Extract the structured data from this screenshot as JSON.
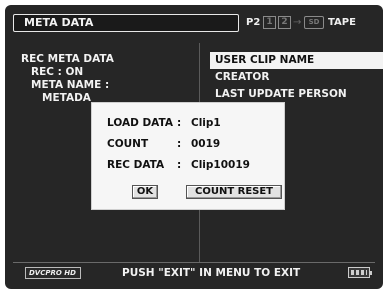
{
  "header": {
    "title": "META DATA",
    "mode": "P2",
    "slot_1": "1",
    "slot_2": "2",
    "arrow": "→",
    "sd_label": "SD",
    "tape": "TAPE"
  },
  "left_panel": {
    "lines": [
      "REC META DATA",
      "REC : ON",
      "META NAME :",
      "METADA"
    ]
  },
  "right_panel": {
    "items": [
      "USER CLIP NAME",
      "CREATOR",
      "LAST UPDATE PERSON"
    ]
  },
  "dialog": {
    "rows": [
      {
        "label": "LOAD DATA",
        "sep": ":",
        "value": "Clip1"
      },
      {
        "label": "COUNT",
        "sep": ":",
        "value": "0019"
      },
      {
        "label": "REC DATA",
        "sep": ":",
        "value": "Clip10019"
      }
    ],
    "ok_label": "OK",
    "reset_label": "COUNT RESET"
  },
  "footer": {
    "logo_text": "DVCPRO HD",
    "status_text": "PUSH \"EXIT\" IN MENU TO EXIT",
    "battery_icon": "battery-icon"
  }
}
